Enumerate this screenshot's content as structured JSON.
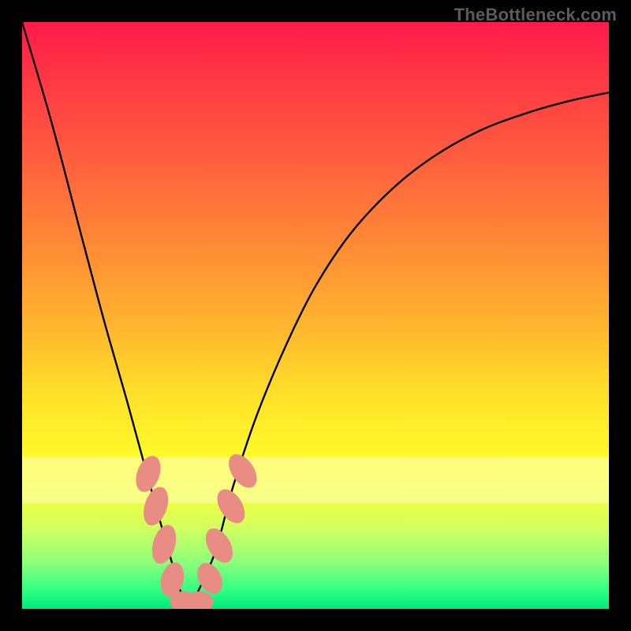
{
  "watermark": "TheBottleneck.com",
  "chart_data": {
    "type": "line",
    "title": "",
    "xlabel": "",
    "ylabel": "",
    "xlim": [
      0,
      100
    ],
    "ylim": [
      0,
      100
    ],
    "grid": false,
    "legend": false,
    "series": [
      {
        "name": "bottleneck-curve",
        "x": [
          0,
          5,
          10,
          14,
          18,
          21,
          23.5,
          25.5,
          27,
          28.5,
          30,
          33,
          36,
          40,
          45,
          50,
          56,
          63,
          70,
          78,
          86,
          93,
          100
        ],
        "y": [
          100,
          83,
          64,
          49,
          35,
          24,
          15,
          8,
          3,
          0.5,
          3,
          10,
          21,
          33,
          45,
          55,
          64,
          71.5,
          77,
          81.5,
          84.5,
          86.5,
          88
        ],
        "stroke": "#000000",
        "stroke_width": 2.4
      }
    ],
    "markers": {
      "name": "highlighted-points",
      "color": "#e98c84",
      "points": [
        {
          "cx": 21.5,
          "cy": 23.0,
          "rx": 1.9,
          "ry": 3.2,
          "rot": 20
        },
        {
          "cx": 22.8,
          "cy": 17.5,
          "rx": 1.9,
          "ry": 3.4,
          "rot": 18
        },
        {
          "cx": 24.2,
          "cy": 11.0,
          "rx": 1.9,
          "ry": 3.4,
          "rot": 16
        },
        {
          "cx": 25.6,
          "cy": 5.0,
          "rx": 1.9,
          "ry": 3.0,
          "rot": 14
        },
        {
          "cx": 27.6,
          "cy": 1.2,
          "rx": 2.4,
          "ry": 1.8,
          "rot": 0
        },
        {
          "cx": 30.2,
          "cy": 1.2,
          "rx": 2.4,
          "ry": 1.8,
          "rot": 0
        },
        {
          "cx": 32.0,
          "cy": 5.2,
          "rx": 1.9,
          "ry": 2.8,
          "rot": -28
        },
        {
          "cx": 33.6,
          "cy": 10.8,
          "rx": 1.9,
          "ry": 3.2,
          "rot": -30
        },
        {
          "cx": 35.6,
          "cy": 17.5,
          "rx": 1.9,
          "ry": 3.2,
          "rot": -32
        },
        {
          "cx": 37.6,
          "cy": 23.5,
          "rx": 1.9,
          "ry": 3.2,
          "rot": -34
        }
      ]
    },
    "background_gradient": {
      "stops": [
        {
          "offset": 0,
          "hex": "#ff1a4b"
        },
        {
          "offset": 8,
          "hex": "#ff3344"
        },
        {
          "offset": 22,
          "hex": "#ff5a3f"
        },
        {
          "offset": 38,
          "hex": "#ff8a35"
        },
        {
          "offset": 52,
          "hex": "#ffb62e"
        },
        {
          "offset": 64,
          "hex": "#ffe22a"
        },
        {
          "offset": 74,
          "hex": "#fff92a"
        },
        {
          "offset": 80,
          "hex": "#f4ff3c"
        },
        {
          "offset": 86,
          "hex": "#d4ff5e"
        },
        {
          "offset": 92,
          "hex": "#8eff7a"
        },
        {
          "offset": 97,
          "hex": "#2dff81"
        },
        {
          "offset": 100,
          "hex": "#00e87a"
        }
      ]
    }
  }
}
